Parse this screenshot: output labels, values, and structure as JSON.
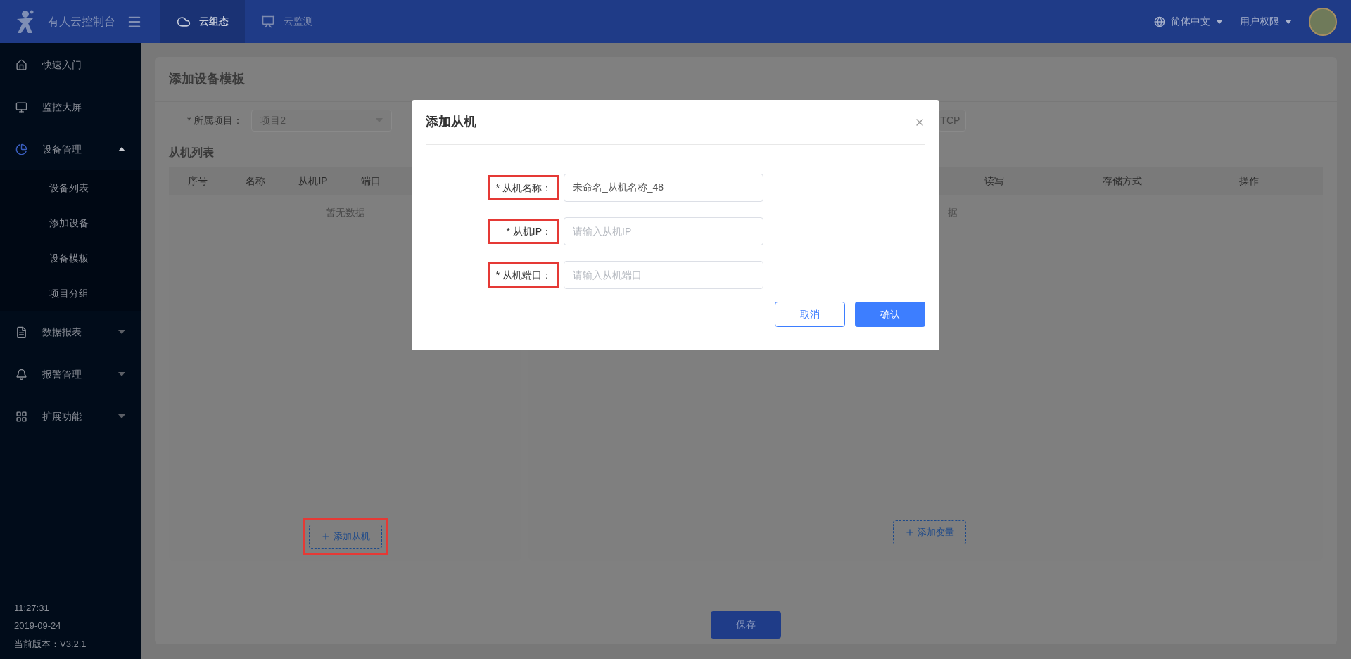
{
  "header": {
    "logo_text": "有人云控制台",
    "tabs": [
      {
        "label": "云组态",
        "selected": true
      },
      {
        "label": "云监测",
        "selected": false
      }
    ],
    "language": "简体中文",
    "user_menu": "用户权限"
  },
  "sidebar": {
    "items": [
      {
        "label": "快速入门"
      },
      {
        "label": "监控大屏"
      },
      {
        "label": "设备管理",
        "expanded": true,
        "children": [
          {
            "label": "设备列表"
          },
          {
            "label": "添加设备"
          },
          {
            "label": "设备模板"
          },
          {
            "label": "项目分组"
          }
        ]
      },
      {
        "label": "数据报表",
        "expanded": false
      },
      {
        "label": "报警管理",
        "expanded": false
      },
      {
        "label": "扩展功能",
        "expanded": false
      }
    ],
    "footer": [
      "11:27:31",
      "2019-09-24",
      "当前版本：V3.2.1"
    ]
  },
  "page": {
    "title": "添加设备模板",
    "form": {
      "project": {
        "label": "* 所属项目：",
        "value": "项目2"
      },
      "protocol_value": "TCP"
    },
    "slave_list": {
      "title": "从机列表",
      "columns": [
        "序号",
        "名称",
        "从机IP",
        "端口"
      ],
      "empty_text": "暂无数据",
      "add_button": {
        "label": "添加从机",
        "highlighted": true
      }
    },
    "variable_list": {
      "columns": [
        "读写",
        "存储方式",
        "操作"
      ],
      "empty_text": "据",
      "add_button": {
        "label": "添加变量"
      }
    },
    "save_button": "保存"
  },
  "dialog": {
    "title": "添加从机",
    "fields": [
      {
        "label": "* 从机名称：",
        "highlighted": true,
        "value": "未命名_从机名称_48"
      },
      {
        "label": "* 从机IP：",
        "highlighted": true,
        "placeholder": "请输入从机IP"
      },
      {
        "label": "* 从机端口：",
        "highlighted": true,
        "placeholder": "请输入从机端口"
      }
    ],
    "cancel_button": "取消",
    "confirm_button": "确认"
  }
}
